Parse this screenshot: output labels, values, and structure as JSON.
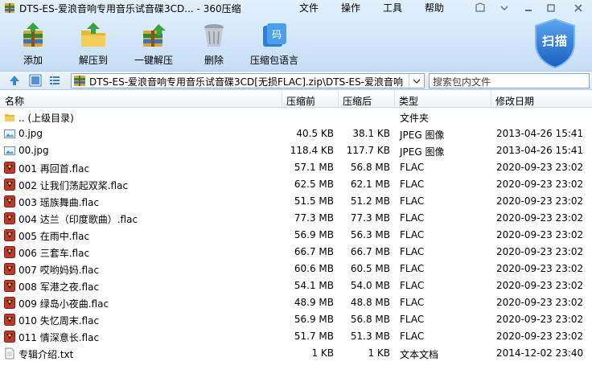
{
  "window": {
    "title": "DTS-ES-爱浪音响专用音乐试音碟3CD... - 360压缩"
  },
  "menu": [
    "文件",
    "操作",
    "工具",
    "帮助"
  ],
  "toolbar": {
    "add": "添加",
    "extract_to": "解压到",
    "one_click_extract": "一键解压",
    "delete": "删除",
    "language": "压缩包语言",
    "scan": "扫描"
  },
  "address": {
    "path": "DTS-ES-爱浪音响专用音乐试音碟3CD[无损FLAC].zip\\DTS-ES-爱浪音响",
    "search_placeholder": "搜索包内文件"
  },
  "columns": {
    "name": "名称",
    "size": "压缩前",
    "compressed": "压缩后",
    "type": "类型",
    "modified": "修改日期"
  },
  "files": [
    {
      "icon": "folder-up-icon",
      "name": ".. (上级目录)",
      "size": "",
      "compressed": "",
      "type": "文件夹",
      "date": ""
    },
    {
      "icon": "image-icon",
      "name": "0.jpg",
      "size": "40.5 KB",
      "compressed": "38.1 KB",
      "type": "JPEG 图像",
      "date": "2013-04-26 15:41"
    },
    {
      "icon": "image-icon",
      "name": "00.jpg",
      "size": "118.4 KB",
      "compressed": "117.7 KB",
      "type": "JPEG 图像",
      "date": "2013-04-26 15:41"
    },
    {
      "icon": "flac-icon",
      "name": "001 再回首.flac",
      "size": "57.1 MB",
      "compressed": "56.8 MB",
      "type": "FLAC",
      "date": "2020-09-23 23:02"
    },
    {
      "icon": "flac-icon",
      "name": "002 让我们荡起双桨.flac",
      "size": "62.5 MB",
      "compressed": "62.1 MB",
      "type": "FLAC",
      "date": "2020-09-23 23:02"
    },
    {
      "icon": "flac-icon",
      "name": "003 瑶族舞曲.flac",
      "size": "51.5 MB",
      "compressed": "51.2 MB",
      "type": "FLAC",
      "date": "2020-09-23 23:02"
    },
    {
      "icon": "flac-icon",
      "name": "004 达兰（印度歌曲）.flac",
      "size": "77.3 MB",
      "compressed": "77.3 MB",
      "type": "FLAC",
      "date": "2020-09-23 23:02"
    },
    {
      "icon": "flac-icon",
      "name": "005 在雨中.flac",
      "size": "56.9 MB",
      "compressed": "56.3 MB",
      "type": "FLAC",
      "date": "2020-09-23 23:02"
    },
    {
      "icon": "flac-icon",
      "name": "006 三套车.flac",
      "size": "66.7 MB",
      "compressed": "66.7 MB",
      "type": "FLAC",
      "date": "2020-09-23 23:02"
    },
    {
      "icon": "flac-icon",
      "name": "007 哎哟妈妈.flac",
      "size": "60.6 MB",
      "compressed": "60.5 MB",
      "type": "FLAC",
      "date": "2020-09-23 23:02"
    },
    {
      "icon": "flac-icon",
      "name": "008 军港之夜.flac",
      "size": "54.1 MB",
      "compressed": "54.0 MB",
      "type": "FLAC",
      "date": "2020-09-23 23:02"
    },
    {
      "icon": "flac-icon",
      "name": "009 绿岛小夜曲.flac",
      "size": "48.9 MB",
      "compressed": "48.8 MB",
      "type": "FLAC",
      "date": "2020-09-23 23:02"
    },
    {
      "icon": "flac-icon",
      "name": "010 失忆周末.flac",
      "size": "56.9 MB",
      "compressed": "56.8 MB",
      "type": "FLAC",
      "date": "2020-09-23 23:02"
    },
    {
      "icon": "flac-icon",
      "name": "011 情深意长.flac",
      "size": "51.7 MB",
      "compressed": "51.3 MB",
      "type": "FLAC",
      "date": "2020-09-23 23:02"
    },
    {
      "icon": "text-file-icon",
      "name": "专辑介绍.txt",
      "size": "1 KB",
      "compressed": "1 KB",
      "type": "文本文档",
      "date": "2014-12-02 23:40"
    }
  ],
  "colors": {
    "toolbar_bg": "#d3e7fa",
    "scan_shield": "#1f6fd1",
    "flac_icon": "#c0392b",
    "folder": "#e8b735"
  }
}
